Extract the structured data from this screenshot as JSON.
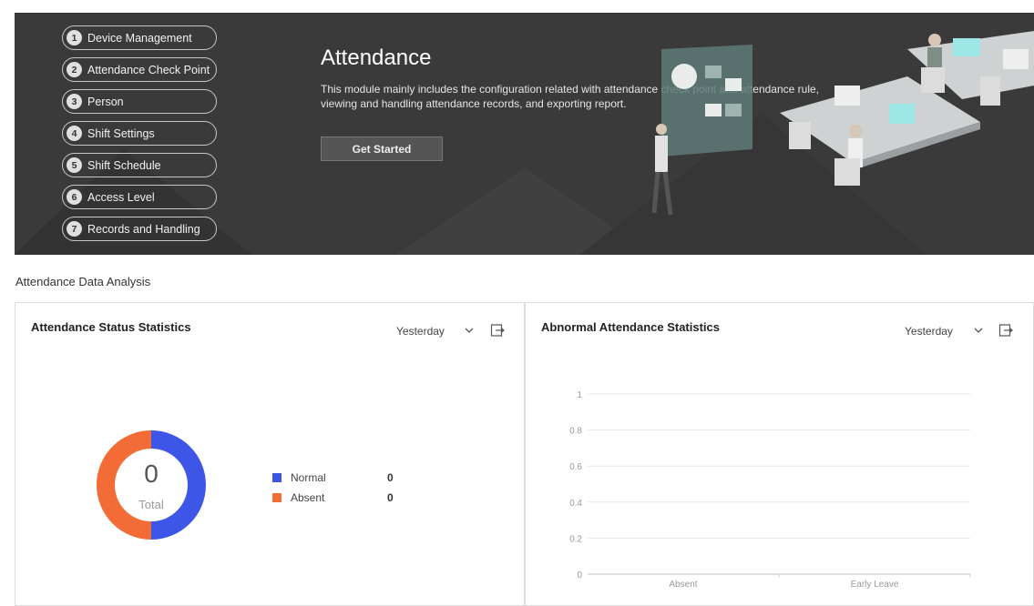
{
  "steps": [
    {
      "num": "1",
      "label": "Device Management"
    },
    {
      "num": "2",
      "label": "Attendance Check Point"
    },
    {
      "num": "3",
      "label": "Person"
    },
    {
      "num": "4",
      "label": "Shift Settings"
    },
    {
      "num": "5",
      "label": "Shift Schedule"
    },
    {
      "num": "6",
      "label": "Access Level"
    },
    {
      "num": "7",
      "label": "Records and Handling"
    }
  ],
  "hero": {
    "title": "Attendance",
    "description": "This module mainly includes the configuration related with attendance check point and attendance rule, viewing and handling attendance records, and exporting report.",
    "button_label": "Get Started"
  },
  "section_title": "Attendance Data Analysis",
  "status_card": {
    "title": "Attendance Status Statistics",
    "period": "Yesterday",
    "total_value": "0",
    "total_label": "Total",
    "legend": [
      {
        "name": "Normal",
        "value": "0",
        "color": "#3d56e8"
      },
      {
        "name": "Absent",
        "value": "0",
        "color": "#f36b36"
      }
    ]
  },
  "abnormal_card": {
    "title": "Abnormal Attendance Statistics",
    "period": "Yesterday"
  },
  "chart_data": {
    "type": "bar",
    "categories": [
      "Absent",
      "Early Leave"
    ],
    "values": [
      0,
      0
    ],
    "title": "Abnormal Attendance Statistics",
    "xlabel": "",
    "ylabel": "",
    "ylim": [
      0,
      1
    ],
    "yticks": [
      "0",
      "0.2",
      "0.4",
      "0.6",
      "0.8",
      "1"
    ],
    "grid": true
  },
  "colors": {
    "banner_bg": "#3a3a3a",
    "normal": "#3d56e8",
    "absent": "#f36b36"
  },
  "icons": [
    "chevron-down-icon",
    "export-icon"
  ]
}
